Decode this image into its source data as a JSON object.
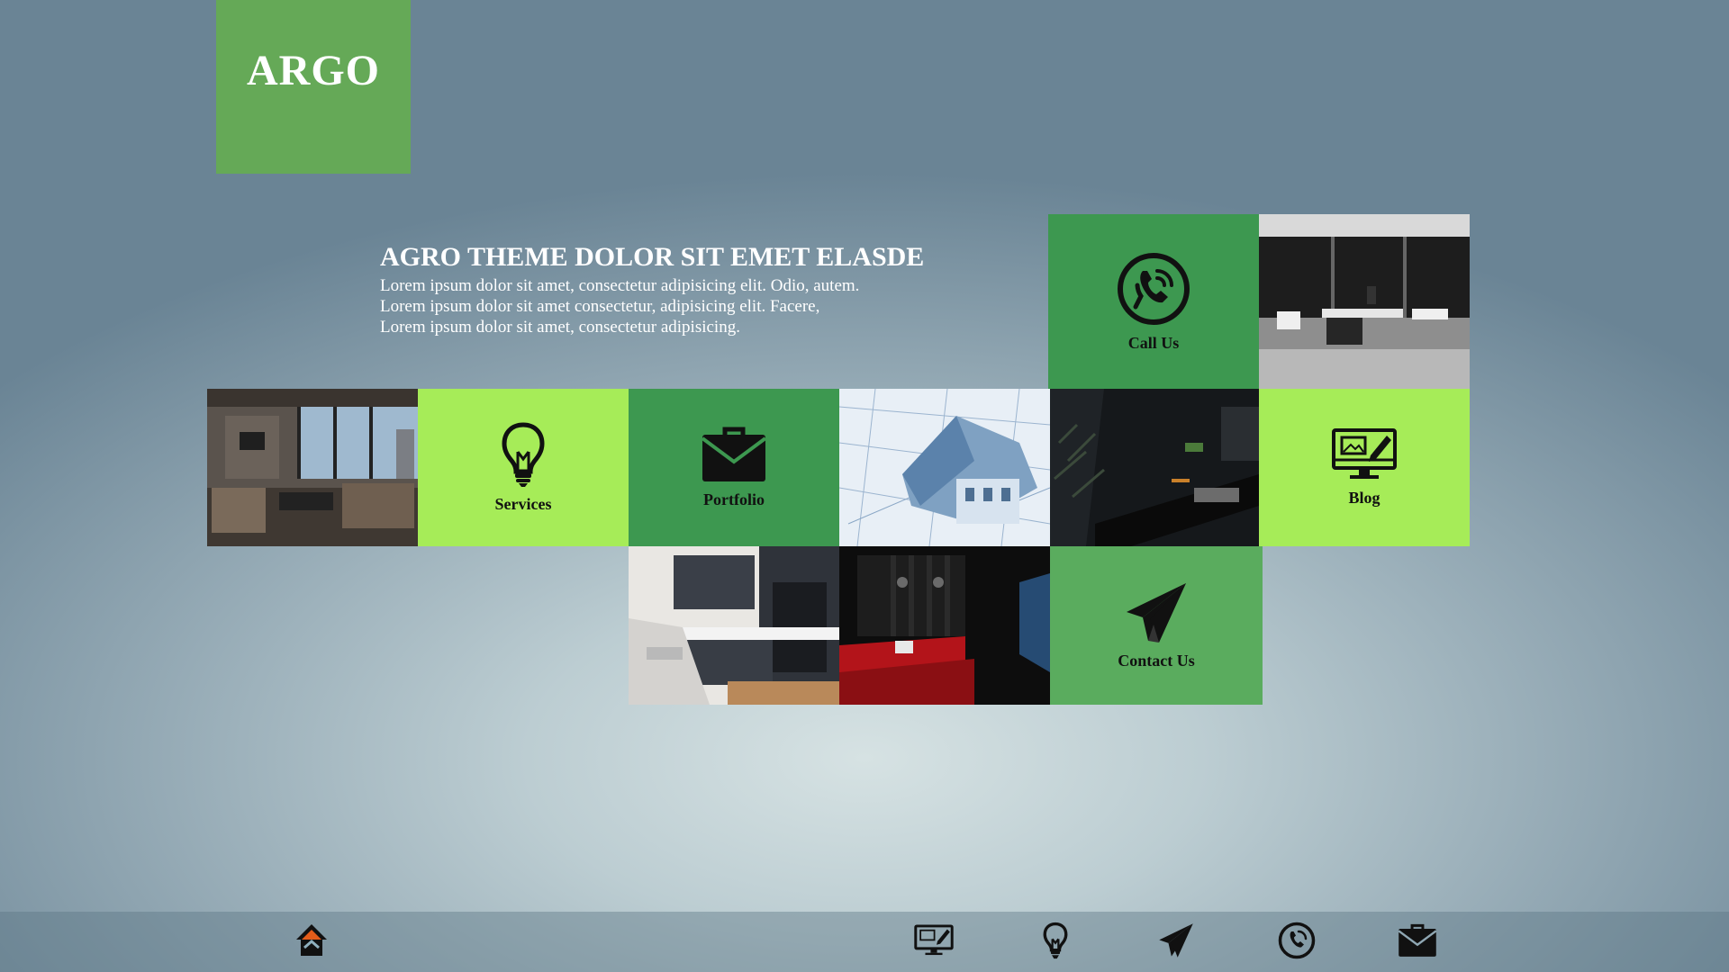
{
  "brand": {
    "name": "ARGO"
  },
  "intro": {
    "title": "AGRO THEME DOLOR SIT EMET ELASDE",
    "lines": [
      "Lorem ipsum dolor sit amet, consectetur adipisicing elit. Odio, autem.",
      "Lorem ipsum dolor sit amet consectetur, adipisicing elit. Facere,",
      "Lorem ipsum dolor sit amet, consectetur adipisicing."
    ]
  },
  "tiles": {
    "call_us": {
      "label": "Call Us",
      "icon": "phone-icon"
    },
    "services": {
      "label": "Services",
      "icon": "lightbulb-icon"
    },
    "portfolio": {
      "label": "Portfolio",
      "icon": "briefcase-icon"
    },
    "blog": {
      "label": "Blog",
      "icon": "monitor-edit-icon"
    },
    "contact_us": {
      "label": "Contact Us",
      "icon": "paper-plane-icon"
    }
  },
  "photos": [
    {
      "subject": "office-interior-photo"
    },
    {
      "subject": "living-room-photo"
    },
    {
      "subject": "house-blueprint-photo"
    },
    {
      "subject": "dark-desk-photo"
    },
    {
      "subject": "kitchen-photo"
    },
    {
      "subject": "home-theater-photo"
    }
  ],
  "footer_nav": [
    {
      "icon": "home-icon"
    },
    {
      "icon": "monitor-edit-icon"
    },
    {
      "icon": "lightbulb-icon"
    },
    {
      "icon": "paper-plane-icon"
    },
    {
      "icon": "phone-icon"
    },
    {
      "icon": "briefcase-icon"
    }
  ],
  "colors": {
    "logo": "#65a957",
    "dark_green_tile": "#3d9850",
    "light_green_tile": "#a6ec58",
    "icon": "#111111",
    "intro_text": "#ffffff"
  }
}
